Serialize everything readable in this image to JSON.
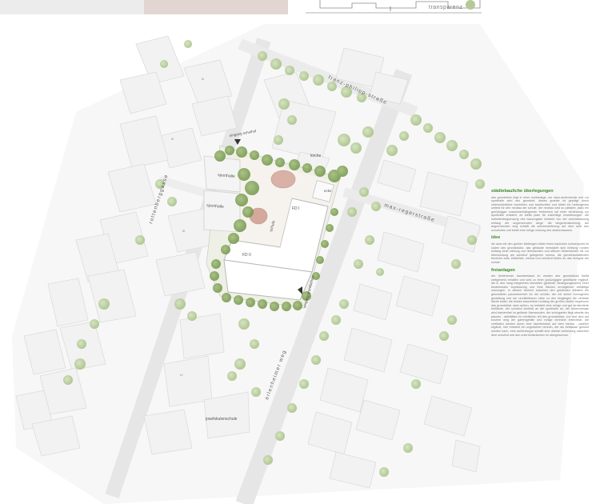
{
  "header": {
    "caption": "transparenz"
  },
  "streets": {
    "north": "franz-philipp-straße",
    "east": "max-regerstraße",
    "west": "rottenberggasse",
    "south": "erlenheimer weg"
  },
  "buildings": {
    "sporthalle_1": "sporthalle",
    "sporthalle_2": "sporthalle",
    "kirche": "kirche",
    "joseftischule": "josefskulenschule",
    "schule_label": "schule",
    "og1": "FD I",
    "og2": "FD II"
  },
  "markers": {
    "eingang_schulhof": "eingang schulhof",
    "eingang_grundschule": "eingang grundschule",
    "ecke": "ecke"
  },
  "text_panel": {
    "sections": [
      {
        "heading": "städtebauliche überlegungen",
        "body": "das grundstück liegt in einer wohlanlage, zur haus-dorferschule und zur sporthalle wird neu geordnet. dieses quartier ist geprägt durch unterschiedliche bauhöhen und baufluchten und bildet ein heterogenes umfeld für den neubau der schule. der neubau wird so platziert, dass ein großzügiger zusammenhängender freibereich mit einer verbindung zur sporthalle entsteht, es bleibt platz für zukünftige erweiterungen. die hofseitenbegrenzung des bauvorgabe entsteht von der wohnbebauung entlang der angrenzenden wege. die langenentwicklung, am angrenzenden weg schafft die schulerweiterung auf dem land des schulhofes und bietet eine ruhige nutzung des straßenraumes."
      },
      {
        "heading": "idee",
        "body": "die aula mit den großen lichtbögen bildet einen baulichen schwerpunkt im süden des grundstücks. das gebäude entwickelt sich richtung norden entlang einer reihung von überdachten und offenen freibereichen bis zur überwindung am schulhof gelegenen mensa. die gemeinschaftlichen bereiche aula, bibliothek, mensa und schulhof bilden so das rückgrat der schule."
      },
      {
        "heading": "freianlagen",
        "body": "der bestehende baumbestand im westen des grundstücks bleibt weitgehend erhalten und wird zu einer großzügigen grünfläche ergänzt. die in den hang integrierten sitzstufen (gelände, bewegungsinseln) einer bestehenden bepflanzung und freie flächen ermöglichen vielfältige nutzungen. in diesem bereich zwischen den gebäuden entsteht ein geschützter pausenbereich für die schüler, der mit seiner homogenen gestaltung und der unmittelbaren nähe zu den eingängen die zentrale fläche bildet. die beiden baumreihen entlang der großen straße begrenzen das grundstück nach außen, es entsteht eine ruhige und gut strukturierte freifläche. der schulhof schließt an die sporthalle an, der höhenversatz wird barrierefrei im gelände überwunden. der schulgarten liegt abseits der pausen - aktivitäten im nördlichen teil des grundstücks, von dort sind auf kurzem weg der gartengeräte und ruhige bereiche erreichbar. die vertikalen werden durch eine dachterrasse auf dem mensa - pavillon ergänzt, hier entsteht ein ungestörter bereich, der als freiklasse genutzt werden kann. eine außentreppe schafft eine direkte verbindung zwischen dem schulhof und den unterrichtsräumen im obergeschoss."
      }
    ]
  }
}
